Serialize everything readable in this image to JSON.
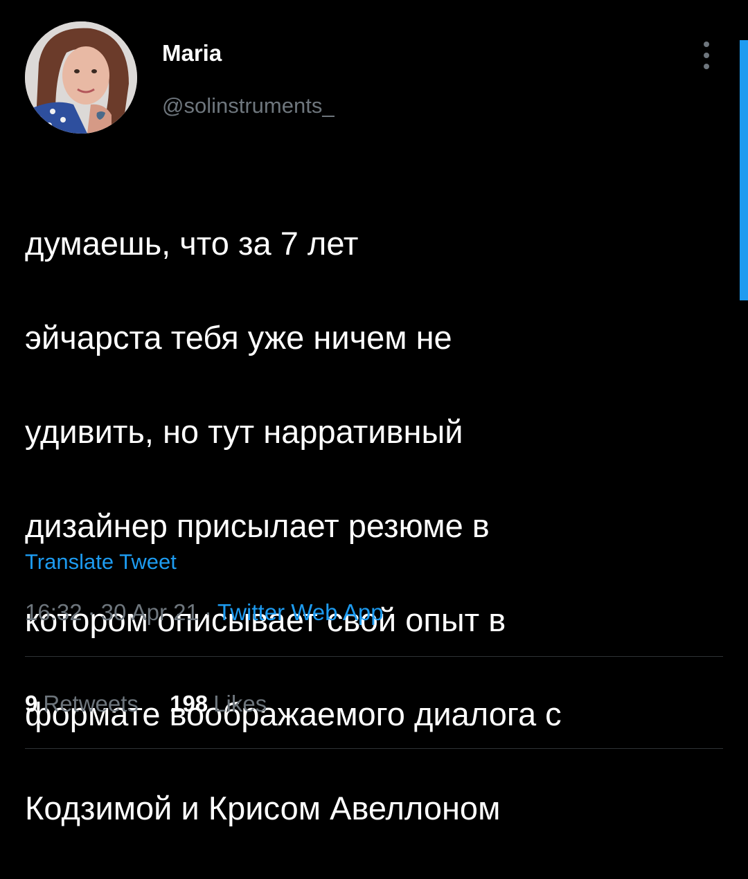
{
  "author": {
    "display_name": "Maria",
    "handle": "@solinstruments_"
  },
  "tweet": {
    "text_lines": [
      "думаешь, что за 7 лет",
      "эйчарста тебя уже ничем не",
      "удивить, но тут нарративный",
      "дизайнер присылает резюме в",
      "котором описывает свой опыт в",
      "формате воображаемого диалога с",
      "Кодзимой и Крисом Авеллоном"
    ],
    "translate_label": "Translate Tweet",
    "time": "16:32",
    "date": "30 Apr 21",
    "separator": "·",
    "source": "Twitter Web App"
  },
  "stats": {
    "retweets_count": "9",
    "retweets_label": "Retweets",
    "likes_count": "198",
    "likes_label": "Likes"
  },
  "icons": {
    "more": "more-vertical-icon"
  },
  "colors": {
    "background": "#000000",
    "text_primary": "#ffffff",
    "text_secondary": "#6e767d",
    "accent": "#1d9bf0",
    "divider": "#2f3336"
  }
}
